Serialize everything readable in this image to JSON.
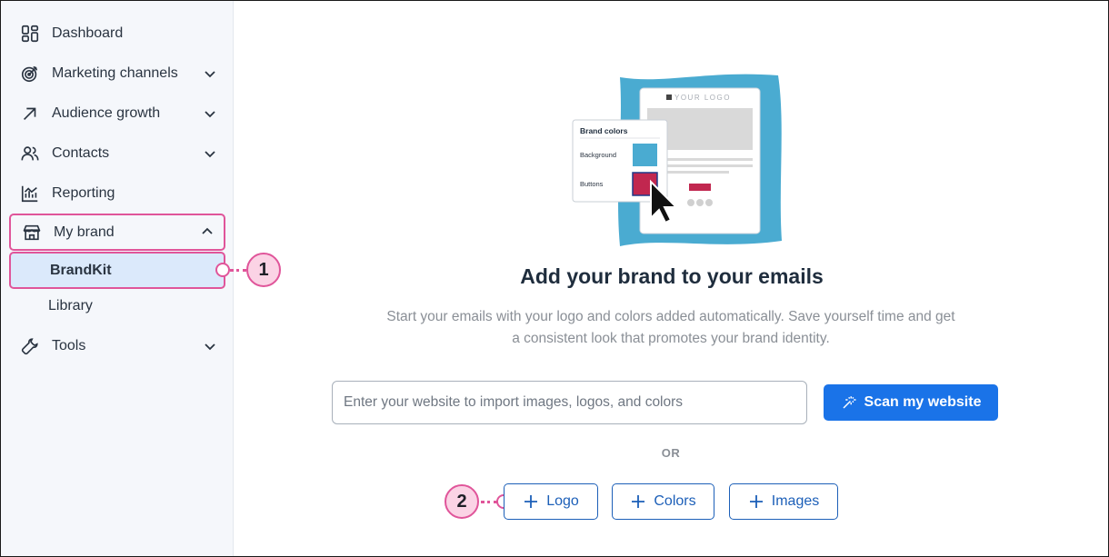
{
  "sidebar": {
    "items": [
      {
        "label": "Dashboard"
      },
      {
        "label": "Marketing channels"
      },
      {
        "label": "Audience growth"
      },
      {
        "label": "Contacts"
      },
      {
        "label": "Reporting"
      },
      {
        "label": "My brand"
      },
      {
        "label": "Tools"
      }
    ],
    "sub_items": [
      {
        "label": "BrandKit"
      },
      {
        "label": "Library"
      }
    ]
  },
  "callouts": [
    "1",
    "2"
  ],
  "illustration": {
    "logo_text": "YOUR LOGO",
    "panel_title": "Brand colors",
    "background_label": "Background",
    "buttons_label": "Buttons",
    "background_color": "#4aabd1",
    "button_color": "#c1274f"
  },
  "main": {
    "title": "Add your brand to your emails",
    "description": "Start your emails with your logo and colors added automatically. Save yourself time and get a consistent look that promotes your brand identity.",
    "url_placeholder": "Enter your website to import images, logos, and colors",
    "scan_button": "Scan my website",
    "or_label": "OR",
    "add_logo": "Logo",
    "add_colors": "Colors",
    "add_images": "Images"
  },
  "colors": {
    "accent": "#1a73e8",
    "highlight": "#e0559a",
    "selected_bg": "#dbe9fb"
  }
}
